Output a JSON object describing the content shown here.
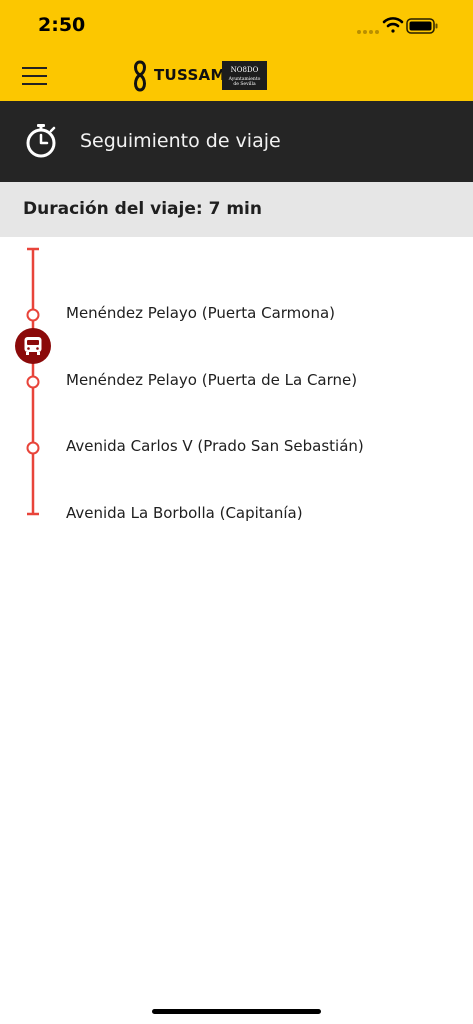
{
  "status_bar": {
    "time": "2:50"
  },
  "app": {
    "brand": "TUSSAM",
    "municipality_line1": "Ayuntamiento",
    "municipality_line2": "de Sevilla"
  },
  "header": {
    "title": "Seguimiento de viaje",
    "icon": "stopwatch-icon"
  },
  "trip": {
    "duration_label": "Duración del viaje: 7 min"
  },
  "stops": [
    {
      "name": "Menéndez Pelayo (Puerta Carmona)"
    },
    {
      "name": "Menéndez Pelayo (Puerta de La Carne)"
    },
    {
      "name": "Avenida Carlos V (Prado San Sebastián)"
    },
    {
      "name": "Avenida La Borbolla (Capitanía)"
    }
  ],
  "colors": {
    "brand_yellow": "#fcc700",
    "header_dark": "#252525",
    "route_red": "#e8443a",
    "bus_marker": "#8b0a0a"
  }
}
